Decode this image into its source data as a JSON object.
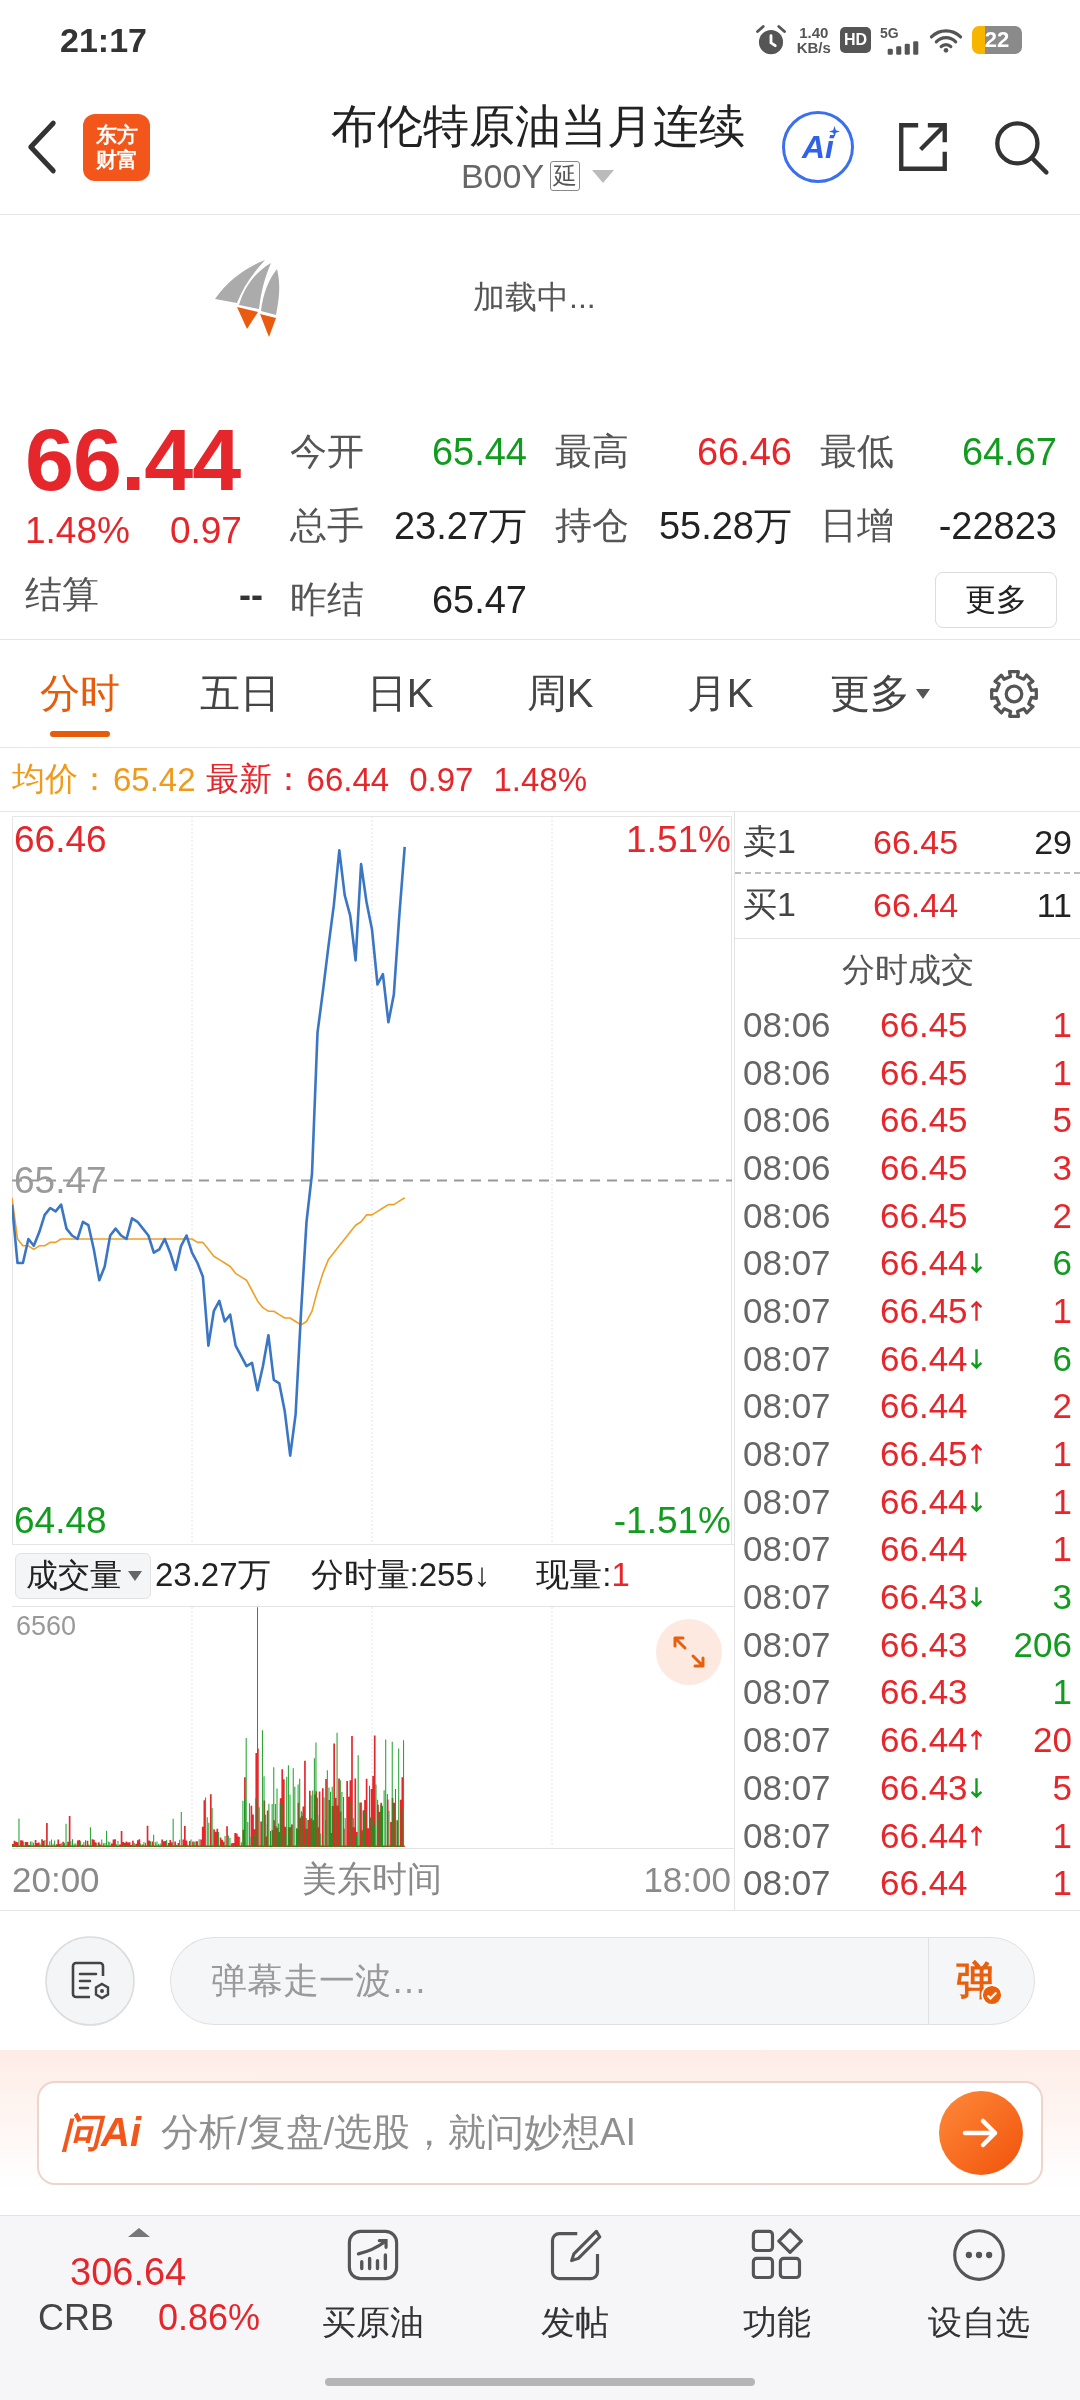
{
  "status_bar": {
    "time": "21:17",
    "net_speed": "1.40",
    "net_unit": "KB/s",
    "hd": "HD",
    "network": "5G",
    "battery": "22"
  },
  "header": {
    "logo_text": "东方财富",
    "title": "布伦特原油当月连续",
    "code": "B00Y",
    "delay_tag": "延",
    "ai_button": "Ai"
  },
  "loading": {
    "text": "加载中..."
  },
  "quote": {
    "price": "66.44",
    "change_pct": "1.48%",
    "change": "0.97",
    "rising": true,
    "settlement_label": "结算",
    "settlement": "--",
    "stats": [
      {
        "label": "今开",
        "value": "65.44",
        "color": "#119b1f"
      },
      {
        "label": "最高",
        "value": "66.46",
        "color": "#e5262b"
      },
      {
        "label": "最低",
        "value": "64.67",
        "color": "#119b1f"
      },
      {
        "label": "总手",
        "value": "23.27万",
        "color": "#222222"
      },
      {
        "label": "持仓",
        "value": "55.28万",
        "color": "#222222"
      },
      {
        "label": "日增",
        "value": "-22823",
        "color": "#222222"
      },
      {
        "label": "昨结",
        "value": "65.47",
        "color": "#222222"
      }
    ],
    "more_button": "更多"
  },
  "tabs": [
    {
      "label": "分时",
      "selected": true,
      "dropdown": false
    },
    {
      "label": "五日",
      "selected": false,
      "dropdown": false
    },
    {
      "label": "日K",
      "selected": false,
      "dropdown": false
    },
    {
      "label": "周K",
      "selected": false,
      "dropdown": false
    },
    {
      "label": "月K",
      "selected": false,
      "dropdown": false
    },
    {
      "label": "更多",
      "selected": false,
      "dropdown": true
    }
  ],
  "summary": {
    "avg_label": "均价：",
    "avg": "65.42",
    "last_label": "最新：",
    "last": "66.44",
    "change": "0.97",
    "change_pct": "1.48%",
    "rising": true
  },
  "price_chart": {
    "right_labels": [
      {
        "text": "1.51%",
        "color": "#e5262b"
      },
      {
        "text": "-1.51%",
        "color": "#119b1f"
      }
    ],
    "chart_data": {
      "type": "line",
      "categories": [
        null,
        null,
        null,
        null,
        null,
        null,
        null,
        null,
        null,
        null,
        null,
        null,
        null,
        null,
        null,
        null,
        null,
        null,
        null,
        null,
        null,
        null,
        null,
        null,
        null,
        null,
        null,
        null,
        null,
        null,
        null,
        null,
        null,
        null,
        null,
        null,
        null,
        null,
        null,
        null,
        null,
        null,
        null,
        null,
        null,
        null,
        null,
        null,
        null,
        null,
        null,
        null,
        null,
        null,
        null,
        null,
        null,
        null,
        null,
        null,
        null,
        null,
        null,
        null,
        null,
        null,
        null,
        null,
        null,
        null,
        null,
        null,
        null,
        null,
        null,
        null,
        null,
        null,
        null,
        null,
        null,
        null,
        null,
        null,
        null,
        null,
        null,
        null,
        null,
        null,
        null,
        null,
        null,
        null,
        null,
        null,
        null,
        null,
        null,
        null,
        null,
        null,
        null,
        null,
        null,
        null,
        null,
        null,
        null,
        null,
        null,
        null,
        null,
        null,
        null,
        null,
        null,
        null,
        null,
        null,
        null,
        null,
        null,
        null,
        null,
        null,
        null,
        null,
        null,
        null,
        null,
        null,
        null
      ],
      "ylim": [
        64.41,
        66.53
      ],
      "yticks": [
        64.48,
        65.47,
        66.46
      ],
      "ref_lines": [
        {
          "axis": "y",
          "value": 65.47
        }
      ],
      "series": [
        {
          "color": "#3a76c4",
          "values": [
            65.4,
            65.23,
            65.23,
            65.3,
            65.28,
            65.32,
            65.37,
            65.39,
            65.38,
            65.4,
            65.33,
            65.31,
            65.3,
            65.35,
            65.34,
            65.27,
            65.18,
            65.22,
            65.31,
            65.33,
            65.31,
            65.3,
            65.36,
            65.35,
            65.33,
            65.31,
            65.26,
            65.27,
            65.3,
            65.26,
            65.21,
            65.28,
            65.31,
            65.26,
            65.23,
            65.19,
            64.99,
            65.09,
            65.12,
            65.06,
            65.08,
            64.99,
            64.96,
            64.93,
            64.94,
            64.86,
            64.93,
            65.02,
            64.89,
            64.88,
            64.8,
            64.67,
            64.79,
            65.09,
            65.35,
            65.49,
            65.9,
            66.02,
            66.15,
            66.27,
            66.43,
            66.3,
            66.24,
            66.11,
            66.39,
            66.28,
            66.2,
            66.04,
            66.07,
            65.93,
            66.01,
            66.24,
            66.44,
            null,
            null,
            null,
            null,
            null,
            null,
            null,
            null,
            null,
            null,
            null,
            null,
            null,
            null,
            null,
            null,
            null,
            null,
            null,
            null,
            null,
            null,
            null,
            null,
            null,
            null,
            null,
            null,
            null,
            null,
            null,
            null,
            null,
            null,
            null,
            null,
            null,
            null,
            null,
            null,
            null,
            null,
            null,
            null,
            null,
            null,
            null,
            null,
            null,
            null,
            null,
            null,
            null,
            null,
            null,
            null,
            null,
            null,
            null,
            null
          ]
        },
        {
          "color": "#f0a024",
          "values": [
            65.42,
            65.3,
            65.28,
            65.28,
            65.27,
            65.28,
            65.28,
            65.29,
            65.29,
            65.3,
            65.3,
            65.3,
            65.3,
            65.3,
            65.3,
            65.3,
            65.3,
            65.3,
            65.3,
            65.3,
            65.3,
            65.3,
            65.3,
            65.3,
            65.3,
            65.3,
            65.3,
            65.3,
            65.3,
            65.3,
            65.3,
            65.3,
            65.3,
            65.3,
            65.29,
            65.29,
            65.27,
            65.25,
            65.24,
            65.23,
            65.22,
            65.2,
            65.19,
            65.18,
            65.15,
            65.12,
            65.1,
            65.09,
            65.09,
            65.08,
            65.07,
            65.07,
            65.06,
            65.05,
            65.06,
            65.09,
            65.15,
            65.2,
            65.24,
            65.26,
            65.28,
            65.3,
            65.32,
            65.34,
            65.35,
            65.37,
            65.37,
            65.38,
            65.39,
            65.4,
            65.4,
            65.41,
            65.42,
            null,
            null,
            null,
            null,
            null,
            null,
            null,
            null,
            null,
            null,
            null,
            null,
            null,
            null,
            null,
            null,
            null,
            null,
            null,
            null,
            null,
            null,
            null,
            null,
            null,
            null,
            null,
            null,
            null,
            null,
            null,
            null,
            null,
            null,
            null,
            null,
            null,
            null,
            null,
            null,
            null,
            null,
            null,
            null,
            null,
            null,
            null,
            null,
            null,
            null,
            null,
            null,
            null,
            null,
            null,
            null,
            null,
            null,
            null,
            null
          ]
        }
      ]
    }
  },
  "order_book": [
    {
      "label": "卖1",
      "price": "66.45",
      "volume": "29"
    },
    {
      "label": "买1",
      "price": "66.44",
      "volume": "11"
    }
  ],
  "trades": {
    "title": "分时成交",
    "rows": [
      {
        "time": "08:06",
        "price": "66.45",
        "kind": "plain",
        "volume": "1",
        "color": "#e5262b"
      },
      {
        "time": "08:06",
        "price": "66.45",
        "kind": "plain",
        "volume": "1",
        "color": "#e5262b"
      },
      {
        "time": "08:06",
        "price": "66.45",
        "kind": "plain",
        "volume": "5",
        "color": "#e5262b"
      },
      {
        "time": "08:06",
        "price": "66.45",
        "kind": "plain",
        "volume": "3",
        "color": "#e5262b"
      },
      {
        "time": "08:06",
        "price": "66.45",
        "kind": "plain",
        "volume": "2",
        "color": "#e5262b"
      },
      {
        "time": "08:07",
        "price": "66.44",
        "kind": "downtick",
        "volume": "6",
        "color": "#119b1f"
      },
      {
        "time": "08:07",
        "price": "66.45",
        "kind": "uptick",
        "volume": "1",
        "color": "#e5262b"
      },
      {
        "time": "08:07",
        "price": "66.44",
        "kind": "downtick",
        "volume": "6",
        "color": "#119b1f"
      },
      {
        "time": "08:07",
        "price": "66.44",
        "kind": "plain",
        "volume": "2",
        "color": "#e5262b"
      },
      {
        "time": "08:07",
        "price": "66.45",
        "kind": "uptick",
        "volume": "1",
        "color": "#e5262b"
      },
      {
        "time": "08:07",
        "price": "66.44",
        "kind": "downtick",
        "volume": "1",
        "color": "#e5262b"
      },
      {
        "time": "08:07",
        "price": "66.44",
        "kind": "plain",
        "volume": "1",
        "color": "#e5262b"
      },
      {
        "time": "08:07",
        "price": "66.43",
        "kind": "downtick",
        "volume": "3",
        "color": "#119b1f"
      },
      {
        "time": "08:07",
        "price": "66.43",
        "kind": "plain",
        "volume": "206",
        "color": "#119b1f"
      },
      {
        "time": "08:07",
        "price": "66.43",
        "kind": "plain",
        "volume": "1",
        "color": "#119b1f"
      },
      {
        "time": "08:07",
        "price": "66.44",
        "kind": "uptick",
        "volume": "20",
        "color": "#e5262b"
      },
      {
        "time": "08:07",
        "price": "66.43",
        "kind": "downtick",
        "volume": "5",
        "color": "#e5262b"
      },
      {
        "time": "08:07",
        "price": "66.44",
        "kind": "uptick",
        "volume": "1",
        "color": "#e5262b"
      },
      {
        "time": "08:07",
        "price": "66.44",
        "kind": "plain",
        "volume": "1",
        "color": "#e5262b"
      }
    ]
  },
  "volume": {
    "selector": "成交量",
    "total": "23.27万",
    "interval": "分时量:255↓",
    "current_label": "现量:",
    "current": "1",
    "max_label": "6560"
  },
  "time_axis": {
    "start": "20:00",
    "zone": "美东时间",
    "end": "18:00"
  },
  "danmaku": {
    "placeholder": "弹幕走一波…",
    "send_button": "弹"
  },
  "ai_bar": {
    "logo": "问Ai",
    "placeholder": "分析/复盘/选股，就问妙想AI"
  },
  "bottom_bar": {
    "index": {
      "value": "306.64",
      "name": "CRB",
      "change": "0.86%",
      "rising": true
    },
    "items": [
      {
        "label": "买原油",
        "kind": "trade"
      },
      {
        "label": "发帖",
        "kind": "post"
      },
      {
        "label": "功能",
        "kind": "tools"
      },
      {
        "label": "设自选",
        "kind": "watch"
      }
    ]
  }
}
